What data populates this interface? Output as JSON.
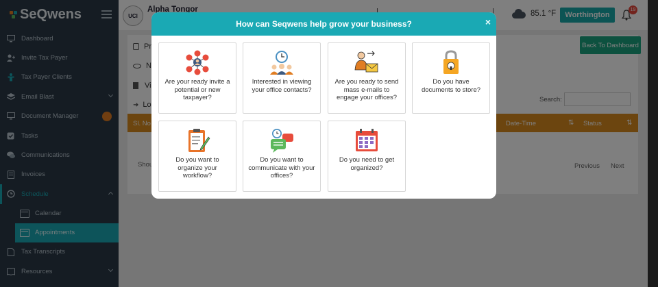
{
  "brand": {
    "name": "SeQwens"
  },
  "sidebar": {
    "items": [
      {
        "label": "Dashboard",
        "icon": "monitor-icon"
      },
      {
        "label": "Invite Tax Payer",
        "icon": "user-plus-icon"
      },
      {
        "label": "Tax Payer Clients",
        "icon": "person-icon"
      },
      {
        "label": "Email Blast",
        "icon": "layers-icon"
      },
      {
        "label": "Document Manager",
        "icon": "monitor-icon"
      },
      {
        "label": "Tasks",
        "icon": "check-icon"
      },
      {
        "label": "Communications",
        "icon": "chat-icon"
      },
      {
        "label": "Invoices",
        "icon": "invoice-icon"
      },
      {
        "label": "Schedule",
        "icon": "clock-icon"
      }
    ],
    "sub_items": [
      {
        "label": "Calendar"
      },
      {
        "label": "Appointments"
      }
    ],
    "bottom_items": [
      {
        "label": "Tax Transcripts",
        "icon": "document-icon"
      },
      {
        "label": "Resources",
        "icon": "book-icon"
      }
    ]
  },
  "topbar": {
    "avatar_text": "UCI",
    "user_name": "Alpha Tongor",
    "temperature": "85.1 °F",
    "org_button": "Worthington",
    "notification_count": "19"
  },
  "content": {
    "rows": [
      "Pr",
      "N",
      "Vi",
      "Lo"
    ],
    "back_button": "Back To Dashboard",
    "search_label": "Search:",
    "table_headers": {
      "sl_no": "Sl. No",
      "date_time": "Date-Time",
      "status": "Status"
    },
    "show_text": "Shou",
    "prev": "Previous",
    "next": "Next"
  },
  "modal": {
    "title": "How can Seqwens help grow your business?",
    "close": "×",
    "cards": [
      {
        "text": "Are your ready invite a potential or new taxpayer?",
        "icon": "network-people-icon"
      },
      {
        "text": "Interested in viewing your office contacts?",
        "icon": "contacts-clock-icon"
      },
      {
        "text": "Are you ready to send mass e-mails to engage your offices?",
        "icon": "send-mail-icon"
      },
      {
        "text": "Do you have documents to store?",
        "icon": "lock-storage-icon"
      },
      {
        "text": "Do you want to organize your workflow?",
        "icon": "clipboard-icon"
      },
      {
        "text": "Do you want to communicate with your offices?",
        "icon": "chat-clock-icon"
      },
      {
        "text": "Do you need to get organized?",
        "icon": "calendar-icon"
      }
    ]
  },
  "colors": {
    "accent": "#1aa9b4",
    "sidebar_bg": "#2b3946",
    "table_header": "#d98a1e",
    "back_button": "#1aa37e"
  }
}
